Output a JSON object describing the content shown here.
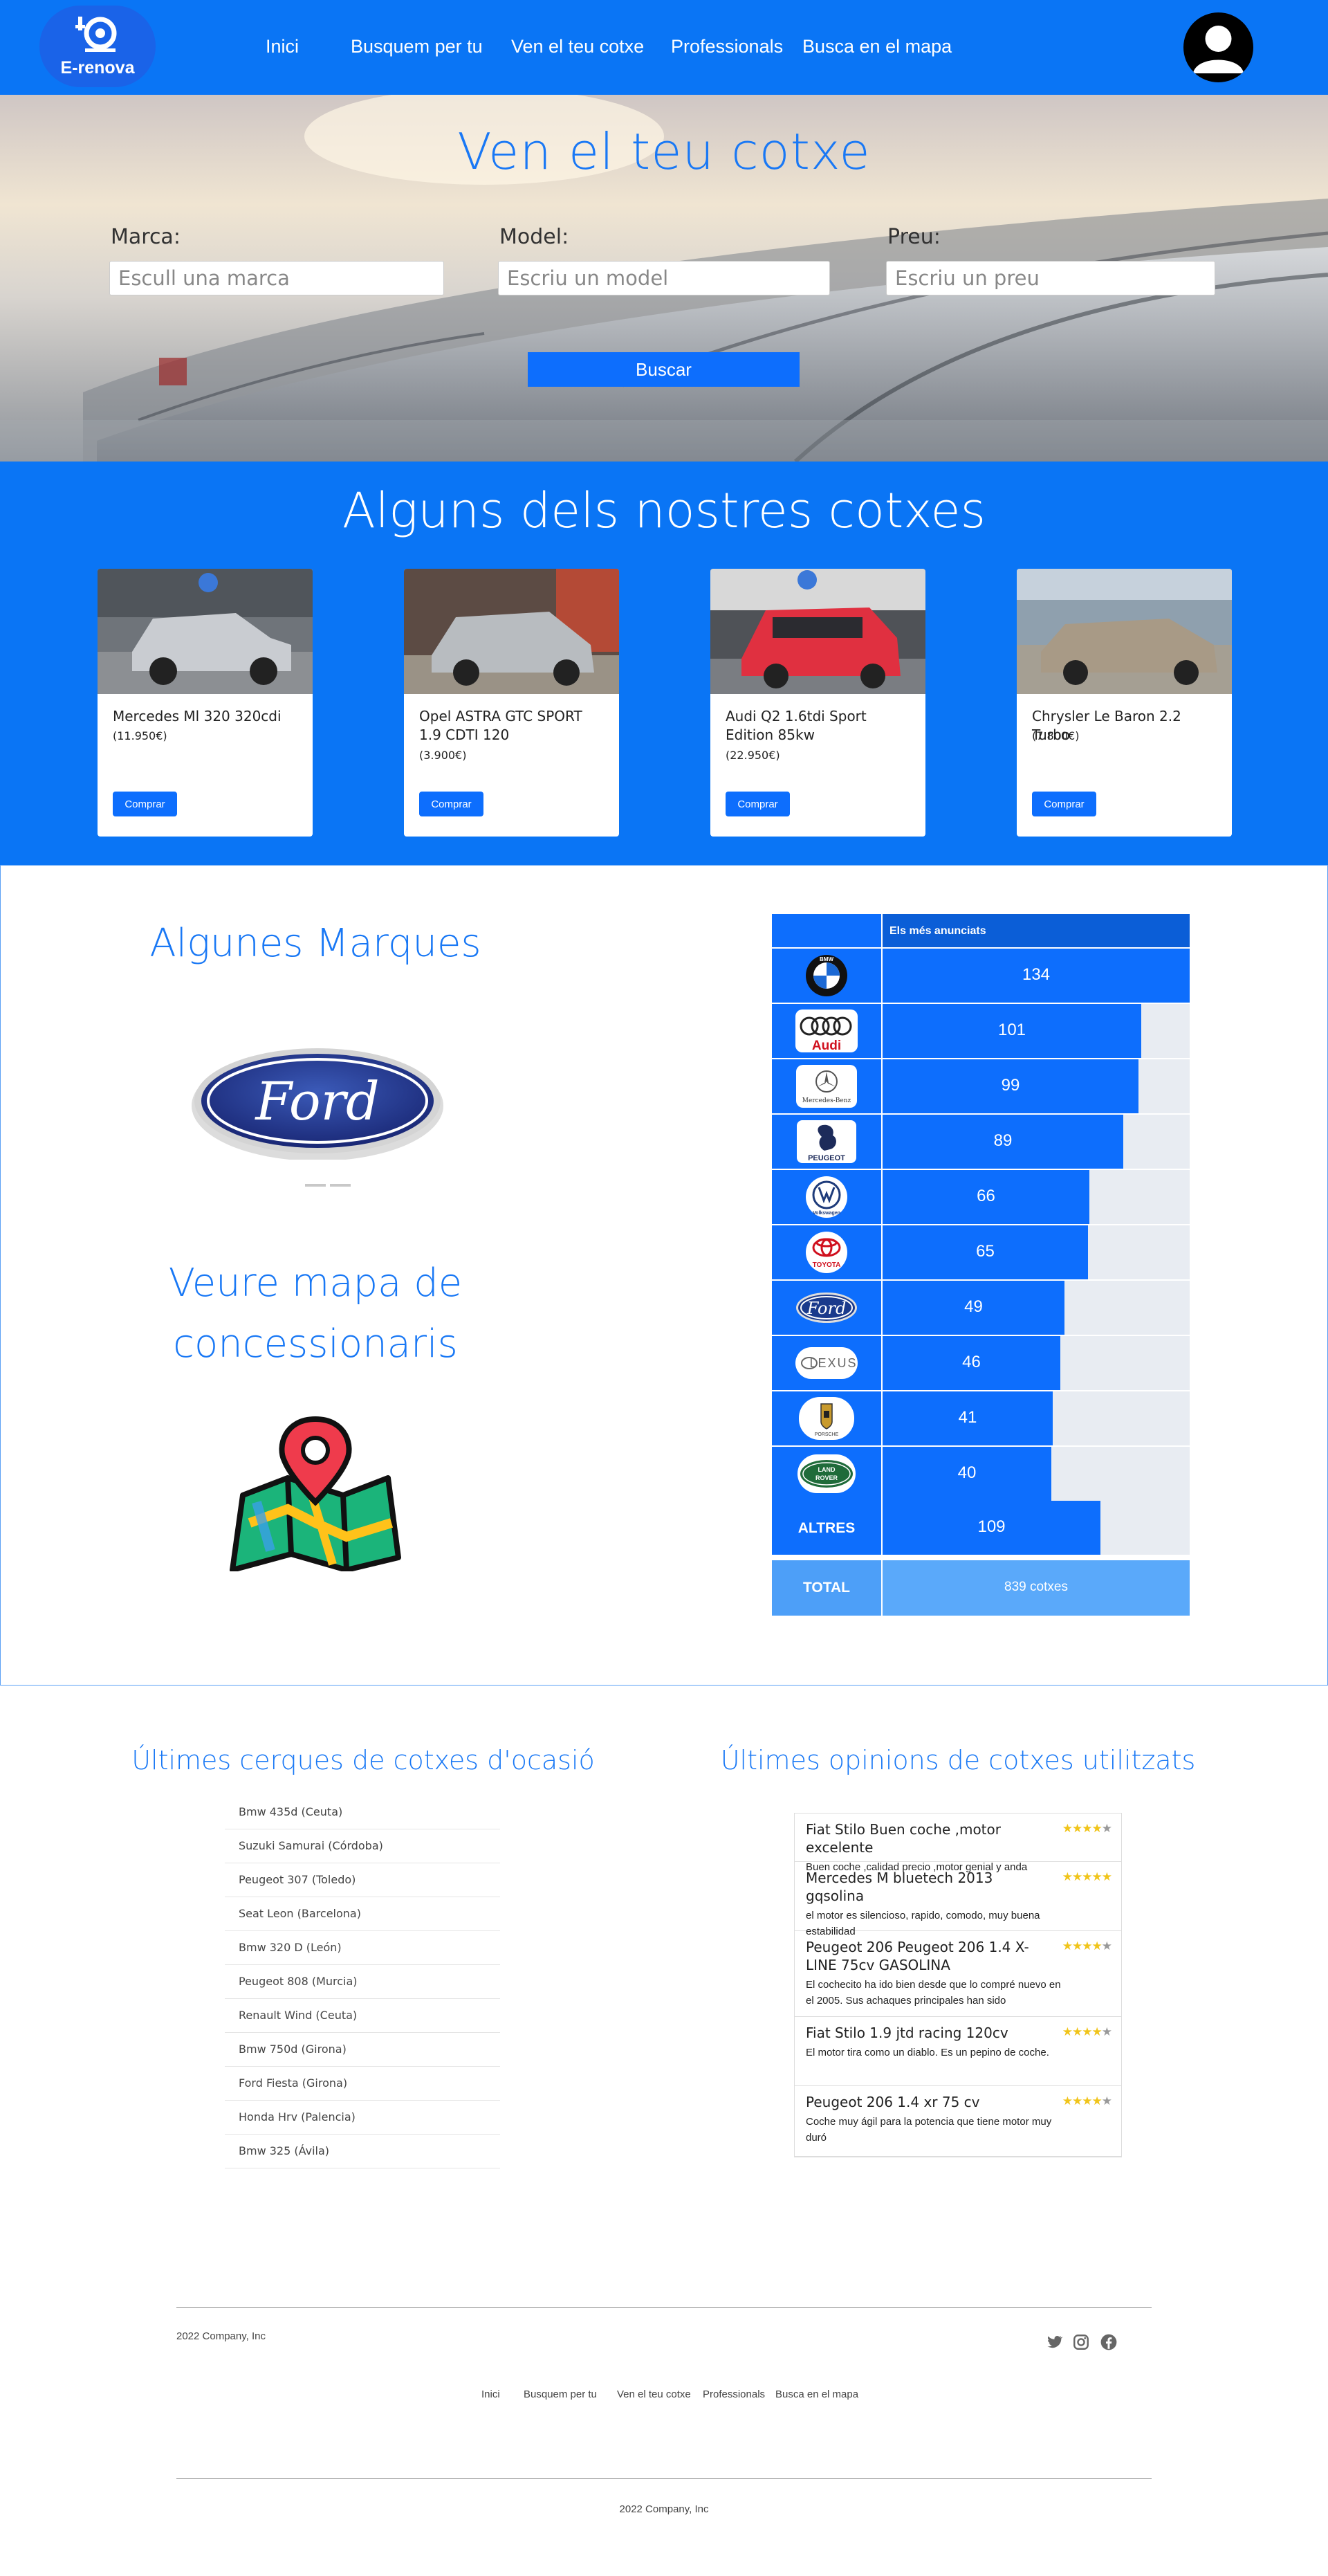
{
  "header": {
    "logo_text": "E-renova",
    "nav": [
      {
        "label": "Inici"
      },
      {
        "label": "Busquem per tu"
      },
      {
        "label": "Ven el teu cotxe"
      },
      {
        "label": "Professionals"
      },
      {
        "label": "Busca en el mapa"
      }
    ]
  },
  "hero": {
    "title": "Ven el teu cotxe",
    "fields": [
      {
        "label": "Marca:",
        "placeholder": "Escull una marca"
      },
      {
        "label": "Model:",
        "placeholder": "Escriu un model"
      },
      {
        "label": "Preu:",
        "placeholder": "Escriu un preu"
      }
    ],
    "button": "Buscar"
  },
  "featured": {
    "title": "Alguns dels nostres cotxes",
    "cars": [
      {
        "name": "Mercedes Ml 320 320cdi",
        "price": "(11.950€)",
        "button": "Comprar",
        "color": "#c9ccd1"
      },
      {
        "name": "Opel ASTRA GTC SPORT 1.9 CDTI 120",
        "price": "(3.900€)",
        "button": "Comprar",
        "color": "#b8bcc0"
      },
      {
        "name": "Audi Q2 1.6tdi Sport Edition 85kw",
        "price": "(22.950€)",
        "button": "Comprar",
        "color": "#e03040"
      },
      {
        "name": "Chrysler Le Baron 2.2 Turbo",
        "price": "(7.800€)",
        "button": "Comprar",
        "color": "#a89a86"
      }
    ]
  },
  "brands": {
    "title": "Algunes Marques",
    "featured_brand": "Ford",
    "map_title_line1": "Veure mapa de",
    "map_title_line2": "concessionaris"
  },
  "ranking": {
    "header": "Els més anunciats",
    "rows": [
      {
        "brand": "BMW",
        "icon": "bmw-logo-icon",
        "value": 134
      },
      {
        "brand": "Audi",
        "icon": "audi-logo-icon",
        "value": 101
      },
      {
        "brand": "Mercedes-Benz",
        "icon": "mercedes-logo-icon",
        "value": 99
      },
      {
        "brand": "Peugeot",
        "icon": "peugeot-logo-icon",
        "value": 89
      },
      {
        "brand": "Volkswagen",
        "icon": "volkswagen-logo-icon",
        "value": 66
      },
      {
        "brand": "Toyota",
        "icon": "toyota-logo-icon",
        "value": 65
      },
      {
        "brand": "Ford",
        "icon": "ford-logo-icon",
        "value": 49
      },
      {
        "brand": "Lexus",
        "icon": "lexus-logo-icon",
        "value": 46
      },
      {
        "brand": "Porsche",
        "icon": "porsche-logo-icon",
        "value": 41
      },
      {
        "brand": "Land Rover",
        "icon": "land-rover-logo-icon",
        "value": 40
      }
    ],
    "others_label": "ALTRES",
    "others_value": 109,
    "total_label": "TOTAL",
    "total_value": "839 cotxes"
  },
  "searches": {
    "title": "Últimes cerques de cotxes d'ocasió",
    "items": [
      "Bmw 435d (Ceuta)",
      "Suzuki Samurai (Córdoba)",
      "Peugeot 307 (Toledo)",
      "Seat Leon (Barcelona)",
      "Bmw 320 D (León)",
      "Peugeot 808 (Murcia)",
      "Renault Wind (Ceuta)",
      "Bmw 750d (Girona)",
      "Ford Fiesta (Girona)",
      "Honda Hrv (Palencia)",
      "Bmw 325 (Ávila)"
    ]
  },
  "opinions": {
    "title": "Últimes opinions de cotxes utilitzats",
    "items": [
      {
        "title": "Fiat Stilo Buen coche ,motor excelente",
        "body": "Buen coche ,calidad precio ,motor genial y anda",
        "stars": 4
      },
      {
        "title": "Mercedes M bluetech 2013 gqsolina",
        "body": "el motor es silencioso, rapido, comodo, muy buena estabilidad",
        "stars": 5
      },
      {
        "title": "Peugeot 206 Peugeot 206 1.4 X-LINE 75cv GASOLINA",
        "body": "El cochecito ha ido bien desde que lo compré nuevo en el 2005. Sus achaques principales han sido",
        "stars": 4
      },
      {
        "title": "Fiat Stilo 1.9 jtd racing 120cv",
        "body": "El motor tira como un diablo. Es un pepino de coche.",
        "stars": 4
      },
      {
        "title": "Peugeot 206 1.4 xr 75 cv",
        "body": "Coche muy ágil para la potencia que tiene motor muy duró",
        "stars": 4
      }
    ]
  },
  "footer": {
    "company": "2022 Company, Inc",
    "nav": [
      "Inici",
      "Busquem per tu",
      "Ven el teu cotxe",
      "Professionals",
      "Busca en el mapa"
    ],
    "social": [
      "twitter-icon",
      "instagram-icon",
      "facebook-icon"
    ],
    "bottom_company": "2022 Company, Inc"
  },
  "colors": {
    "brand_blue": "#0a75f5",
    "button_blue": "#0d6efd",
    "title_blue": "#1978f5"
  }
}
